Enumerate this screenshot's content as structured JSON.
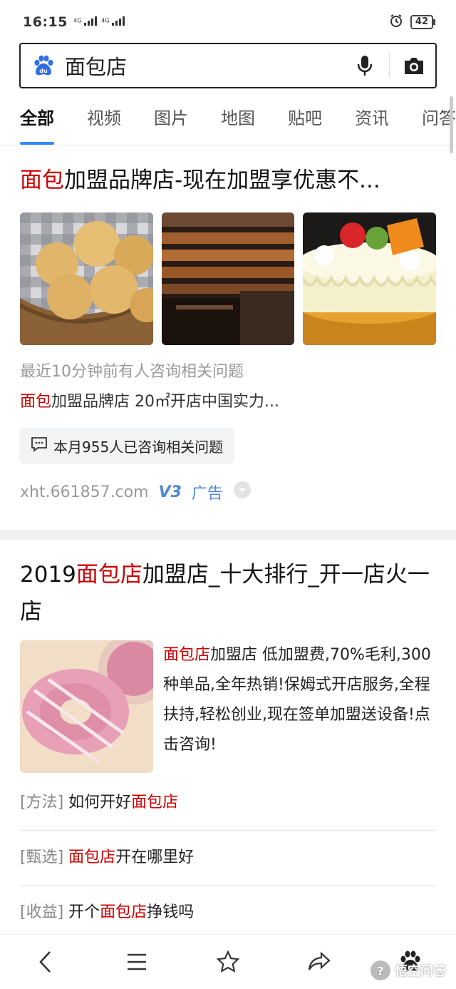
{
  "status": {
    "time": "16:15",
    "net1": "4G",
    "net2": "4G",
    "battery": "42"
  },
  "search": {
    "query": "面包店"
  },
  "tabs": [
    "全部",
    "视频",
    "图片",
    "地图",
    "贴吧",
    "资讯",
    "问答"
  ],
  "ad": {
    "title_hl": "面包",
    "title_rest": "加盟品牌店-现在加盟享优惠不...",
    "recent": "最近10分钟前有人咨询相关问题",
    "desc_hl": "面包",
    "desc_rest": "加盟品牌店 20㎡开店中国实力...",
    "consult": "本月955人已咨询相关问题",
    "url": "xht.661857.com",
    "v3": "V3",
    "ad_label": "广告"
  },
  "result": {
    "title_a": "2019",
    "title_hl": "面包店",
    "title_b": "加盟店_十大排行_开一店火一店",
    "text_hl": "面包店",
    "text_rest": "加盟店 低加盟费,70%毛利,300种单品,全年热销!保姆式开店服务,全程扶持,轻松创业,现在签单加盟送设备!点击咨询!",
    "links": [
      {
        "tag": "[方法]",
        "pre": " 如何开好",
        "hl": "面包店",
        "post": ""
      },
      {
        "tag": "[甄选]",
        "pre": " ",
        "hl": "面包店",
        "post": "开在哪里好"
      },
      {
        "tag": "[收益]",
        "pre": " 开个",
        "hl": "面包店",
        "post": "挣钱吗"
      }
    ]
  },
  "watermark": "悟空问答",
  "colors": {
    "highlight": "#cc0000",
    "accent": "#3388ff",
    "ad": "#4d88d9"
  }
}
